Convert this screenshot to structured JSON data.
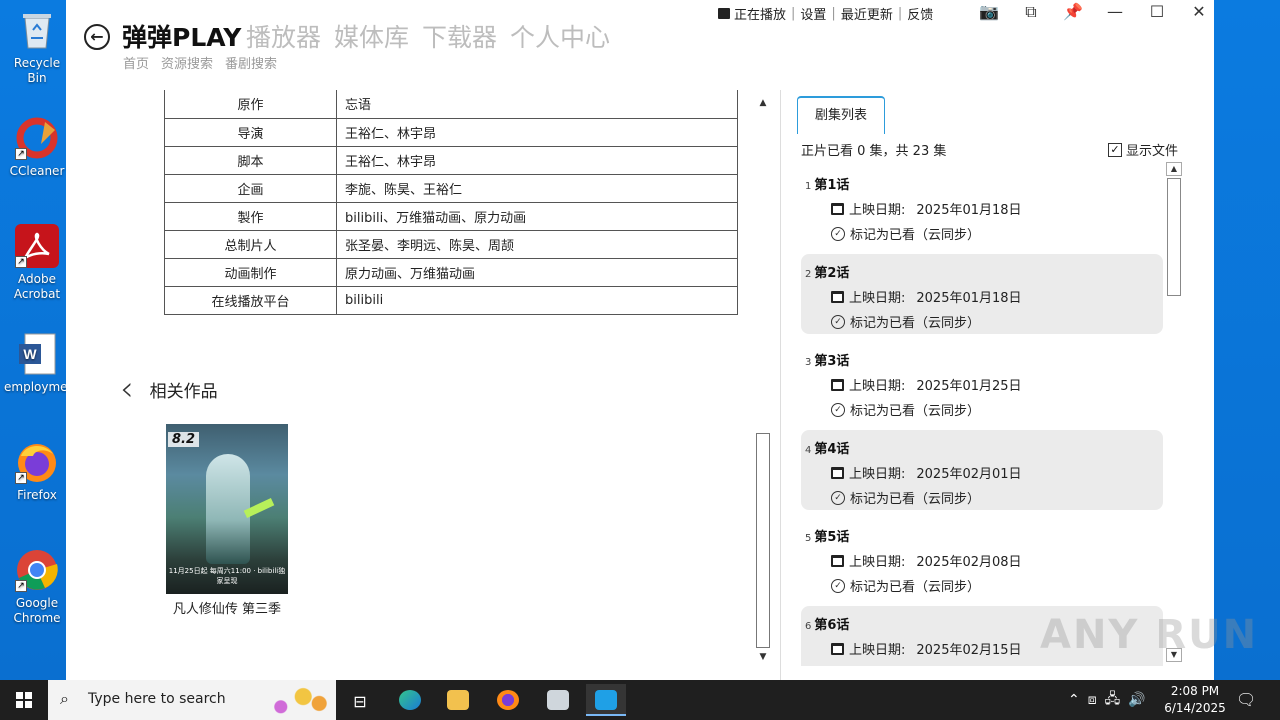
{
  "desktop": {
    "icons": [
      {
        "label": "Recycle Bin",
        "icon": "recycle-bin-icon"
      },
      {
        "label": "CCleaner",
        "icon": "ccleaner-icon"
      },
      {
        "label": "Adobe Acrobat",
        "icon": "acrobat-icon"
      },
      {
        "label": "employme...",
        "icon": "word-doc-icon"
      },
      {
        "label": "Firefox",
        "icon": "firefox-icon"
      },
      {
        "label": "Google Chrome",
        "icon": "chrome-icon"
      }
    ]
  },
  "app": {
    "brand": "弹弹PLAY",
    "nav": [
      "播放器",
      "媒体库",
      "下载器",
      "个人中心"
    ],
    "subnav": [
      "首页",
      "资源搜索",
      "番剧搜索"
    ],
    "toplinks": [
      "正在播放",
      "设置",
      "最近更新",
      "反馈"
    ],
    "info_rows": [
      {
        "k": "原作",
        "v": "忘语"
      },
      {
        "k": "导演",
        "v": "王裕仁、林宇昂"
      },
      {
        "k": "脚本",
        "v": "王裕仁、林宇昂"
      },
      {
        "k": "企画",
        "v": "李旎、陈昊、王裕仁"
      },
      {
        "k": "製作",
        "v": "bilibili、万维猫动画、原力动画"
      },
      {
        "k": "总制片人",
        "v": "张圣晏、李明远、陈昊、周颉"
      },
      {
        "k": "动画制作",
        "v": "原力动画、万维猫动画"
      },
      {
        "k": "在线播放平台",
        "v": "bilibili"
      }
    ],
    "related": {
      "title": "相关作品",
      "items": [
        {
          "score": "8.2",
          "title": "凡人修仙传 第三季",
          "poster_caption": "11月25日起 每周六11:00 · bilibili独家呈现"
        }
      ]
    },
    "episodes_panel": {
      "tab": "剧集列表",
      "progress": "正片已看 0 集，共 23 集",
      "show_files_label": "显示文件",
      "show_files_checked": true,
      "air_label": "上映日期:",
      "mark_label": "标记为已看（云同步）",
      "episodes": [
        {
          "num": "1",
          "title": "第1话",
          "date": "2025年01月18日"
        },
        {
          "num": "2",
          "title": "第2话",
          "date": "2025年01月18日"
        },
        {
          "num": "3",
          "title": "第3话",
          "date": "2025年01月25日"
        },
        {
          "num": "4",
          "title": "第4话",
          "date": "2025年02月01日"
        },
        {
          "num": "5",
          "title": "第5话",
          "date": "2025年02月08日"
        },
        {
          "num": "6",
          "title": "第6话",
          "date": "2025年02月15日"
        }
      ]
    }
  },
  "watermark": "ANY RUN",
  "taskbar": {
    "search_placeholder": "Type here to search",
    "time": "2:08 PM",
    "date": "6/14/2025"
  },
  "colors": {
    "accent": "#2d9cdb",
    "desktop": "#0a78d7",
    "taskbar": "#1f1f1f"
  }
}
